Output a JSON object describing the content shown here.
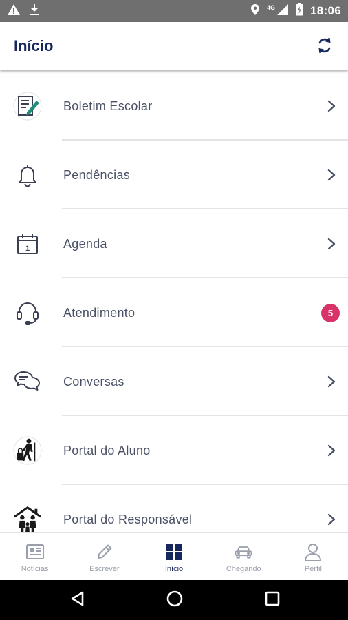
{
  "status_bar": {
    "time": "18:06",
    "network": "4G",
    "icons": [
      "warning-icon",
      "download-icon",
      "location-icon",
      "signal-icon",
      "battery-icon"
    ]
  },
  "header": {
    "title": "Início",
    "refresh_icon": "refresh-icon"
  },
  "menu": {
    "items": [
      {
        "label": "Boletim Escolar",
        "icon": "report-card-icon"
      },
      {
        "label": "Pendências",
        "icon": "bell-icon"
      },
      {
        "label": "Agenda",
        "icon": "calendar-icon",
        "icon_text": "1"
      },
      {
        "label": "Atendimento",
        "icon": "headset-icon",
        "badge": "5"
      },
      {
        "label": "Conversas",
        "icon": "chat-bubbles-icon"
      },
      {
        "label": "Portal do Aluno",
        "icon": "student-icon"
      },
      {
        "label": "Portal do Responsável",
        "icon": "family-icon"
      }
    ]
  },
  "bottom_nav": {
    "items": [
      {
        "label": "Notícias",
        "icon": "newspaper-icon",
        "active": false
      },
      {
        "label": "Escrever",
        "icon": "pencil-icon",
        "active": false
      },
      {
        "label": "Início",
        "icon": "grid-icon",
        "active": true
      },
      {
        "label": "Chegando",
        "icon": "car-icon",
        "active": false
      },
      {
        "label": "Perfil",
        "icon": "user-icon",
        "active": false
      }
    ]
  },
  "colors": {
    "primary": "#16275c",
    "label": "#4a5166",
    "inactive": "#9a9fab",
    "badge": "#d9346a",
    "accent_green": "#1f8f7a",
    "status_bar": "#6f6f6f"
  }
}
